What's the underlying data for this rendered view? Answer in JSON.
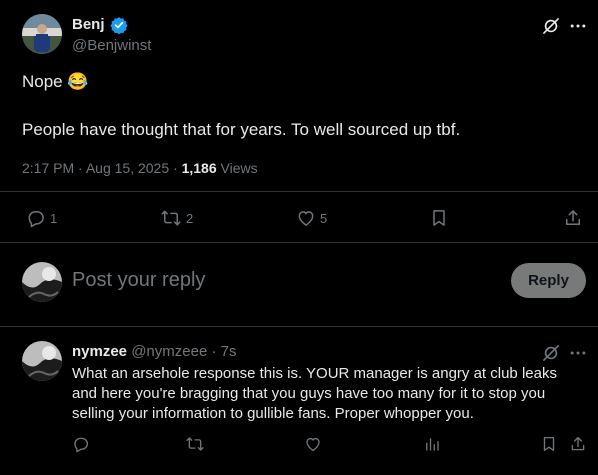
{
  "main_post": {
    "author": {
      "name": "Benj",
      "handle": "@Benjwinst",
      "verified": true
    },
    "line1_text": "Nope",
    "line1_emoji": "😂",
    "line2_text": "People have thought that for years. To well sourced up tbf.",
    "meta": {
      "time": "2:17 PM",
      "sep1": "·",
      "date": "Aug 15, 2025",
      "sep2": "·",
      "views_count": "1,186",
      "views_label": "Views"
    },
    "actions": {
      "reply_count": "1",
      "repost_count": "2",
      "like_count": "5"
    }
  },
  "compose": {
    "placeholder": "Post your reply",
    "button_label": "Reply"
  },
  "reply": {
    "author_name": "nymzee",
    "handle": "@nymzeee",
    "sep": "·",
    "age": "7s",
    "body_lines": [
      "What an arsehole response this is. YOUR manager is angry at club leaks",
      "and here you're bragging that you guys have too many for it to stop you",
      "selling your information to gullible fans. Proper whopper you."
    ]
  },
  "colors": {
    "background": "#000000",
    "text": "#e7e9ea",
    "muted": "#71767b",
    "verified": "#1d9bf0",
    "divider": "#2f3336",
    "reply_button_bg": "#787a7a",
    "reply_button_text": "#0f1419"
  },
  "icons": [
    "grok-icon",
    "more-icon",
    "verified-badge-icon",
    "reply-icon",
    "repost-icon",
    "like-icon",
    "bookmark-icon",
    "share-icon",
    "views-icon"
  ]
}
